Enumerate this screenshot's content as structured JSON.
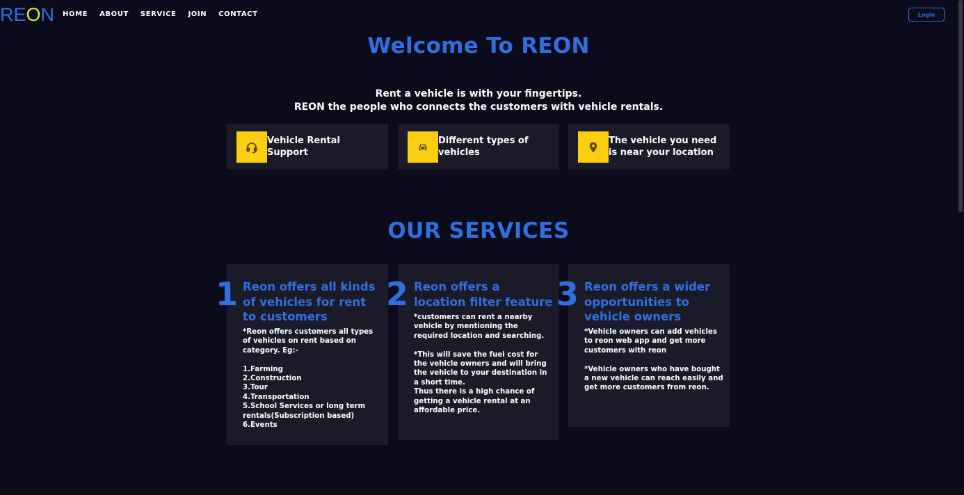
{
  "navbar": {
    "logo_letters": [
      {
        "char": "R",
        "color": "#2f6fe0"
      },
      {
        "char": "E",
        "color": "#2f6fe0"
      },
      {
        "char": "O",
        "color": "#d8f21c"
      },
      {
        "char": "N",
        "color": "#2f6fe0"
      }
    ],
    "links": [
      "HOME",
      "ABOUT",
      "SERVICE",
      "JOIN",
      "CONTACT"
    ],
    "login_label": "Login"
  },
  "hero": {
    "title": "Welcome To REON",
    "tagline_line1": "Rent a vehicle is with your fingertips.",
    "tagline_line2": "REON the people who connects the customers with vehicle rentals."
  },
  "features": [
    {
      "icon": "headset-icon",
      "text": "Vehicle Rental Support"
    },
    {
      "icon": "car-icon",
      "text": "Different types of vehicles"
    },
    {
      "icon": "location-pin-icon",
      "text": "The vehicle you need is near your location"
    }
  ],
  "services": {
    "title": "OUR SERVICES",
    "items": [
      {
        "number": "1",
        "title": "Reon offers all kinds of vehicles for rent to customers",
        "description": "*Reon offers customers all types of vehicles on rent based on category. Eg:-\n\n1.Farming\n2.Construction\n3.Tour\n4.Transportation\n5.School Services or long term rentals(Subscription based)\n6.Events"
      },
      {
        "number": "2",
        "title": "Reon offers a location filter feature",
        "description": "*customers can rent a nearby vehicle by mentioning the required location and searching.\n\n*This will save the fuel cost for the vehicle owners and will bring the vehicle to your destination in a short time.\nThus there is a high chance of getting a vehicle rental at an affordable price."
      },
      {
        "number": "3",
        "title": "Reon offers a wider opportunities to vehicle owners",
        "description": "*Vehicle owners can add vehicles to reon web app and get more customers with reon\n\n*Vehicle owners who have bought a new vehicle can reach easily and get more customers from reon."
      }
    ]
  },
  "colors": {
    "background": "#0c0b1b",
    "card": "#1b1a28",
    "accent_blue": "#2f6fe0",
    "accent_yellow": "#fbce0f"
  }
}
